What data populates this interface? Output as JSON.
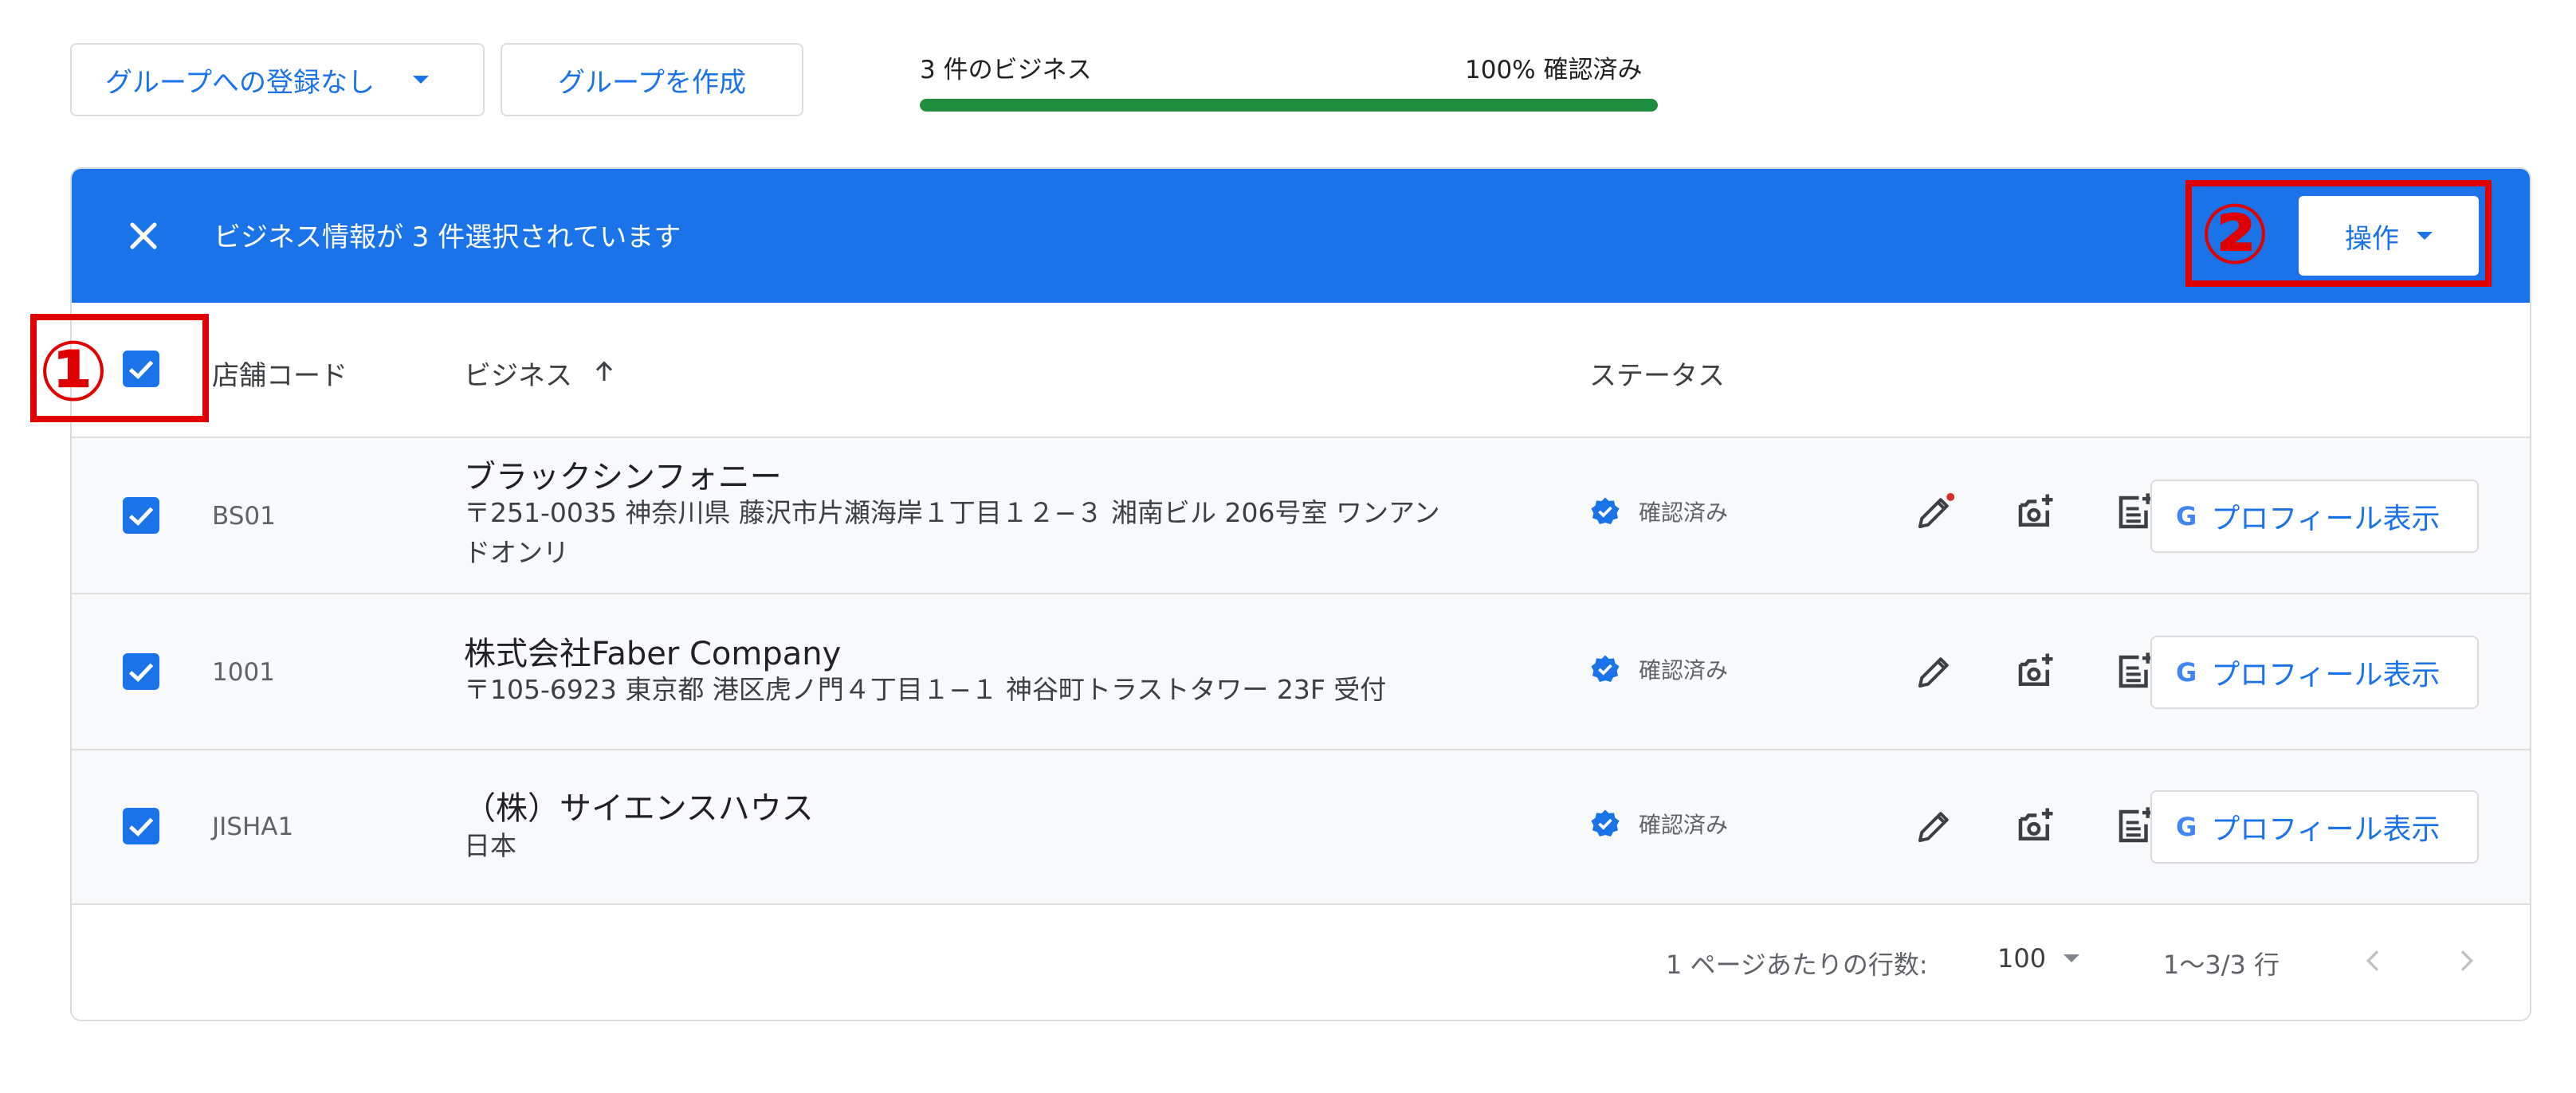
{
  "toolbar": {
    "group_filter_label": "グループへの登録なし",
    "create_group_label": "グループを作成",
    "business_count": "3 件のビジネス",
    "verified_pct": "100% 確認済み",
    "progress_fraction": 1.0
  },
  "selection": {
    "text": "ビジネス情報が 3 件選択されています",
    "actions_label": "操作"
  },
  "columns": {
    "code": "店舗コード",
    "business": "ビジネス",
    "status": "ステータス"
  },
  "rows": [
    {
      "code": "BS01",
      "name": "ブラックシンフォニー",
      "address1": "〒251-0035 神奈川県 藤沢市片瀬海岸１丁目１２−３ 湘南ビル 206号室 ワンアン",
      "address2": "ドオンリ",
      "status": "確認済み",
      "profile": "プロフィール表示"
    },
    {
      "code": "1001",
      "name": "株式会社Faber Company",
      "address1": "〒105-6923 東京都 港区虎ノ門４丁目１−１ 神谷町トラストタワー 23F 受付",
      "address2": "",
      "status": "確認済み",
      "profile": "プロフィール表示"
    },
    {
      "code": "JISHA1",
      "name": "（株）サイエンスハウス",
      "address1": "日本",
      "address2": "",
      "status": "確認済み",
      "profile": "プロフィール表示"
    }
  ],
  "footer": {
    "rows_per_page_label": "1 ページあたりの行数:",
    "rows_per_page_value": "100",
    "range": "1〜3/3 行"
  },
  "annotations": {
    "one": "①",
    "two": "②"
  },
  "colors": {
    "accent": "#1a73e8",
    "progress": "#1e8e3e",
    "annotation": "#e00000"
  }
}
